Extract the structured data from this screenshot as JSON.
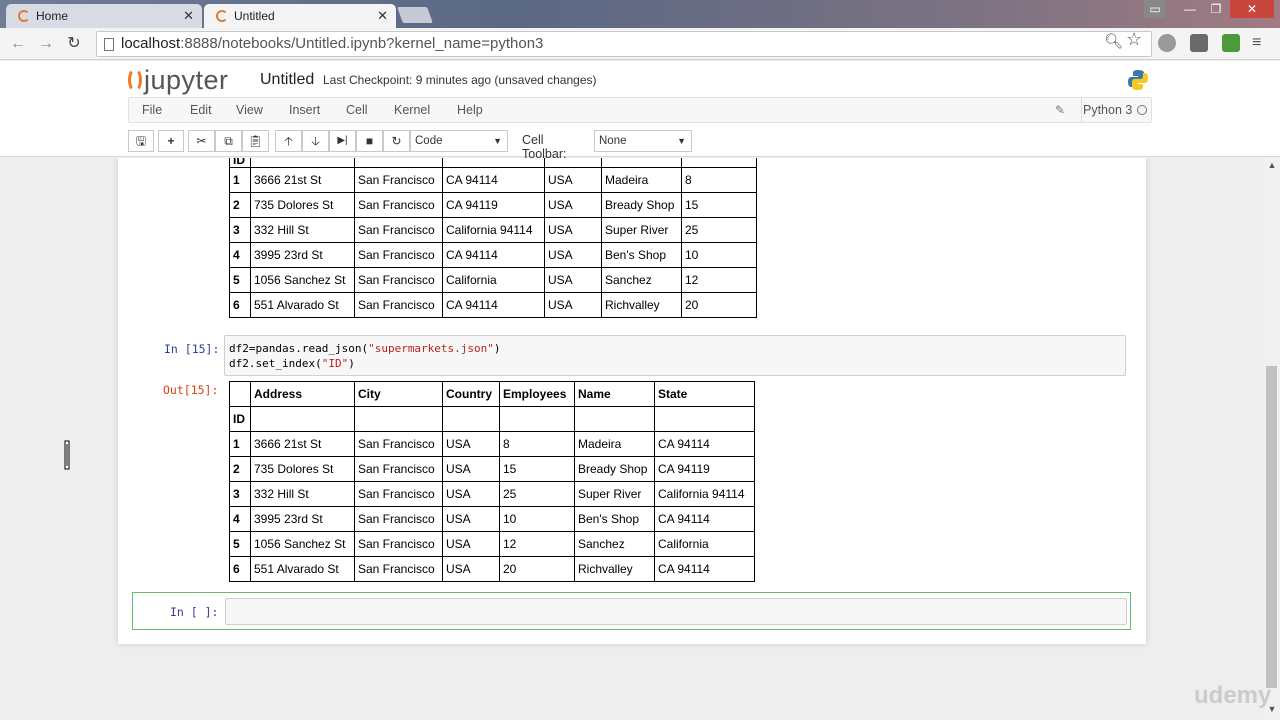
{
  "browser": {
    "tabs": [
      {
        "title": "Home"
      },
      {
        "title": "Untitled"
      }
    ],
    "url_host": "localhost",
    "url_path": ":8888/notebooks/Untitled.ipynb?kernel_name=python3"
  },
  "jupyter": {
    "logo_text": "jupyter",
    "notebook_name": "Untitled",
    "checkpoint": "Last Checkpoint: 9 minutes ago (unsaved changes)",
    "menu": [
      "File",
      "Edit",
      "View",
      "Insert",
      "Cell",
      "Kernel",
      "Help"
    ],
    "kernel_name": "Python 3",
    "cell_type": "Code",
    "cell_toolbar_label": "Cell Toolbar:",
    "cell_toolbar_value": "None"
  },
  "output_prev": {
    "partial_header": "ID",
    "rows": [
      [
        "1",
        "3666 21st St",
        "San Francisco",
        "CA 94114",
        "USA",
        "Madeira",
        "8"
      ],
      [
        "2",
        "735 Dolores St",
        "San Francisco",
        "CA 94119",
        "USA",
        "Bready Shop",
        "15"
      ],
      [
        "3",
        "332 Hill St",
        "San Francisco",
        "California 94114",
        "USA",
        "Super River",
        "25"
      ],
      [
        "4",
        "3995 23rd St",
        "San Francisco",
        "CA 94114",
        "USA",
        "Ben's Shop",
        "10"
      ],
      [
        "5",
        "1056 Sanchez St",
        "San Francisco",
        "California",
        "USA",
        "Sanchez",
        "12"
      ],
      [
        "6",
        "551 Alvarado St",
        "San Francisco",
        "CA 94114",
        "USA",
        "Richvalley",
        "20"
      ]
    ]
  },
  "cell15": {
    "in_prompt": "In [15]:",
    "code_line1_pre": "df2=pandas.read_json(",
    "code_line1_str": "\"supermarkets.json\"",
    "code_line1_post": ")",
    "code_line2_pre": "df2.set_index(",
    "code_line2_str": "\"ID\"",
    "code_line2_post": ")",
    "out_prompt": "Out[15]:",
    "columns": [
      "Address",
      "City",
      "Country",
      "Employees",
      "Name",
      "State"
    ],
    "index_name": "ID",
    "rows": [
      [
        "1",
        "3666 21st St",
        "San Francisco",
        "USA",
        "8",
        "Madeira",
        "CA 94114"
      ],
      [
        "2",
        "735 Dolores St",
        "San Francisco",
        "USA",
        "15",
        "Bready Shop",
        "CA 94119"
      ],
      [
        "3",
        "332 Hill St",
        "San Francisco",
        "USA",
        "25",
        "Super River",
        "California 94114"
      ],
      [
        "4",
        "3995 23rd St",
        "San Francisco",
        "USA",
        "10",
        "Ben's Shop",
        "CA 94114"
      ],
      [
        "5",
        "1056 Sanchez St",
        "San Francisco",
        "USA",
        "12",
        "Sanchez",
        "California"
      ],
      [
        "6",
        "551 Alvarado St",
        "San Francisco",
        "USA",
        "20",
        "Richvalley",
        "CA 94114"
      ]
    ]
  },
  "empty_cell": {
    "in_prompt": "In [ ]:"
  },
  "watermark": "udemy",
  "colors": {
    "accent": "#f37726",
    "prompt_in": "#303f9f",
    "prompt_out": "#d84315",
    "edit_border": "#66bb6a"
  }
}
